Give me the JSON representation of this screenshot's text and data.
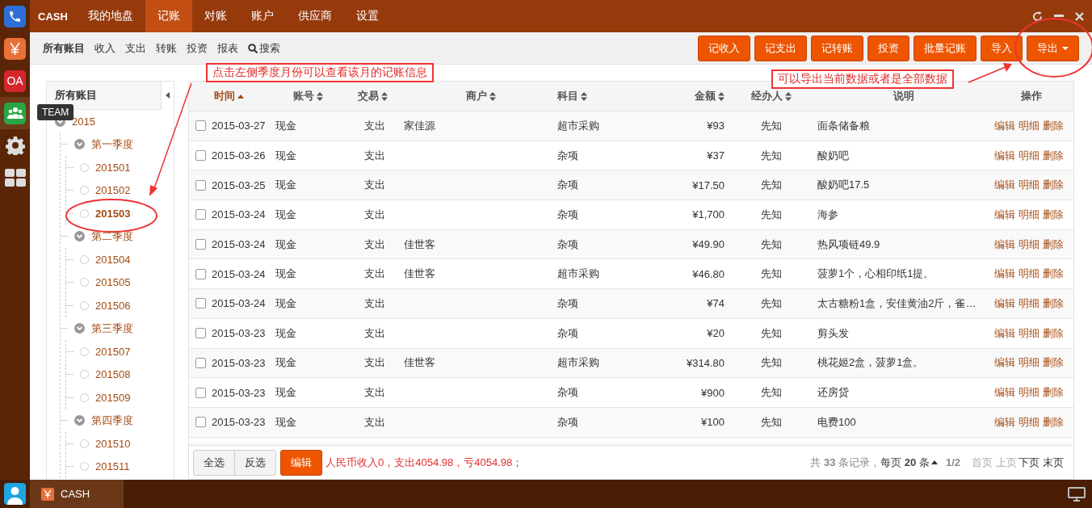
{
  "dock": {
    "apps": [
      {
        "kind": "phone",
        "selected": false
      },
      {
        "kind": "yen",
        "selected": false
      },
      {
        "kind": "oa",
        "label": "OA",
        "selected": false
      },
      {
        "kind": "team",
        "selected": true,
        "tooltip": "TEAM"
      },
      {
        "kind": "gear",
        "selected": false
      },
      {
        "kind": "grid",
        "selected": false
      }
    ]
  },
  "topbar": {
    "brand": "CASH",
    "tabs": [
      {
        "label": "我的地盘",
        "selected": false
      },
      {
        "label": "记账",
        "selected": true
      },
      {
        "label": "对账",
        "selected": false
      },
      {
        "label": "账户",
        "selected": false
      },
      {
        "label": "供应商",
        "selected": false
      },
      {
        "label": "设置",
        "selected": false
      }
    ]
  },
  "subnav": {
    "items": [
      {
        "label": "所有账目",
        "selected": true
      },
      {
        "label": "收入",
        "selected": false
      },
      {
        "label": "支出",
        "selected": false
      },
      {
        "label": "转账",
        "selected": false
      },
      {
        "label": "投资",
        "selected": false
      },
      {
        "label": "报表",
        "selected": false
      },
      {
        "label": "搜索",
        "selected": false,
        "kind": "search"
      }
    ],
    "buttons": [
      {
        "label": "记收入"
      },
      {
        "label": "记支出"
      },
      {
        "label": "记转账"
      },
      {
        "label": "投资"
      },
      {
        "label": "批量记账"
      },
      {
        "label": "导入"
      },
      {
        "label": "导出",
        "kind": "dropdown"
      }
    ]
  },
  "tree": {
    "title": "所有账目",
    "items": [
      {
        "label": "2015",
        "expanded": true,
        "selected": false,
        "children": [
          {
            "label": "第一季度",
            "expanded": true,
            "selected": false,
            "children": [
              {
                "label": "201501",
                "selected": false
              },
              {
                "label": "201502",
                "selected": false
              },
              {
                "label": "201503",
                "selected": true
              }
            ]
          },
          {
            "label": "第二季度",
            "expanded": true,
            "selected": false,
            "children": [
              {
                "label": "201504",
                "selected": false
              },
              {
                "label": "201505",
                "selected": false
              },
              {
                "label": "201506",
                "selected": false
              }
            ]
          },
          {
            "label": "第三季度",
            "expanded": true,
            "selected": false,
            "children": [
              {
                "label": "201507",
                "selected": false
              },
              {
                "label": "201508",
                "selected": false
              },
              {
                "label": "201509",
                "selected": false
              }
            ]
          },
          {
            "label": "第四季度",
            "expanded": true,
            "selected": false,
            "children": [
              {
                "label": "201510",
                "selected": false
              },
              {
                "label": "201511",
                "selected": false
              }
            ]
          }
        ]
      }
    ]
  },
  "table": {
    "columns": [
      {
        "label": "时间",
        "sortable": true,
        "sorted_ascending": true
      },
      {
        "label": "账号",
        "sortable": true,
        "sorted_ascending": false
      },
      {
        "label": "交易",
        "sortable": true,
        "sorted_ascending": false
      },
      {
        "label": "商户",
        "sortable": true,
        "sorted_ascending": false
      },
      {
        "label": "科目",
        "sortable": true,
        "sorted_ascending": false
      },
      {
        "label": "金额",
        "sortable": true,
        "sorted_ascending": false
      },
      {
        "label": "经办人",
        "sortable": true,
        "sorted_ascending": false
      },
      {
        "label": "说明",
        "sortable": false
      },
      {
        "label": "操作",
        "sortable": false
      }
    ],
    "rows": [
      {
        "checked": false,
        "cells": [
          "2015-03-27",
          "现金",
          "支出",
          "家佳源",
          "超市采购",
          "¥93",
          "先知",
          "面条储备粮"
        ],
        "actions": [
          "编辑",
          "明细",
          "删除"
        ]
      },
      {
        "checked": false,
        "cells": [
          "2015-03-26",
          "现金",
          "支出",
          "",
          "杂项",
          "¥37",
          "先知",
          "酸奶吧"
        ],
        "actions": [
          "编辑",
          "明细",
          "删除"
        ]
      },
      {
        "checked": false,
        "cells": [
          "2015-03-25",
          "现金",
          "支出",
          "",
          "杂项",
          "¥17.50",
          "先知",
          "酸奶吧17.5"
        ],
        "actions": [
          "编辑",
          "明细",
          "删除"
        ]
      },
      {
        "checked": false,
        "cells": [
          "2015-03-24",
          "现金",
          "支出",
          "",
          "杂项",
          "¥1,700",
          "先知",
          "海参"
        ],
        "actions": [
          "编辑",
          "明细",
          "删除"
        ]
      },
      {
        "checked": false,
        "cells": [
          "2015-03-24",
          "现金",
          "支出",
          "佳世客",
          "杂项",
          "¥49.90",
          "先知",
          "热风项链49.9"
        ],
        "actions": [
          "编辑",
          "明细",
          "删除"
        ]
      },
      {
        "checked": false,
        "cells": [
          "2015-03-24",
          "现金",
          "支出",
          "佳世客",
          "超市采购",
          "¥46.80",
          "先知",
          "菠萝1个，心相印纸1提。"
        ],
        "actions": [
          "编辑",
          "明细",
          "删除"
        ]
      },
      {
        "checked": false,
        "cells": [
          "2015-03-24",
          "现金",
          "支出",
          "",
          "杂项",
          "¥74",
          "先知",
          "太古糖粉1盒，安佳黄油2斤，雀…"
        ],
        "actions": [
          "编辑",
          "明细",
          "删除"
        ]
      },
      {
        "checked": false,
        "cells": [
          "2015-03-23",
          "现金",
          "支出",
          "",
          "杂项",
          "¥20",
          "先知",
          "剪头发"
        ],
        "actions": [
          "编辑",
          "明细",
          "删除"
        ]
      },
      {
        "checked": false,
        "cells": [
          "2015-03-23",
          "现金",
          "支出",
          "佳世客",
          "超市采购",
          "¥314.80",
          "先知",
          "桃花姬2盒，菠萝1盒。"
        ],
        "actions": [
          "编辑",
          "明细",
          "删除"
        ]
      },
      {
        "checked": false,
        "cells": [
          "2015-03-23",
          "现金",
          "支出",
          "",
          "杂项",
          "¥900",
          "先知",
          "还房贷"
        ],
        "actions": [
          "编辑",
          "明细",
          "删除"
        ]
      },
      {
        "checked": false,
        "cells": [
          "2015-03-23",
          "现金",
          "支出",
          "",
          "杂项",
          "¥100",
          "先知",
          "电费100"
        ],
        "actions": [
          "编辑",
          "明细",
          "删除"
        ]
      }
    ]
  },
  "footer": {
    "select_buttons": [
      "全选",
      "反选"
    ],
    "edit_button": "编辑",
    "summary": "人民币收入0，支出4054.98，亏4054.98；",
    "records": "共 **33** 条记录，",
    "page_size": "每页 **20** 条",
    "page": "1/2",
    "pager": [
      {
        "label": "首页",
        "disabled": true
      },
      {
        "label": "上页",
        "disabled": true
      },
      {
        "label": "下页",
        "disabled": false
      },
      {
        "label": "末页",
        "disabled": false
      }
    ]
  },
  "taskbar": {
    "items": [
      {
        "label": "CASH",
        "selected": true
      }
    ]
  },
  "annotations": [
    {
      "text": "点击左侧季度月份可以查看该月的记账信息"
    },
    {
      "text": "可以导出当前数据或者是全部数据"
    }
  ]
}
